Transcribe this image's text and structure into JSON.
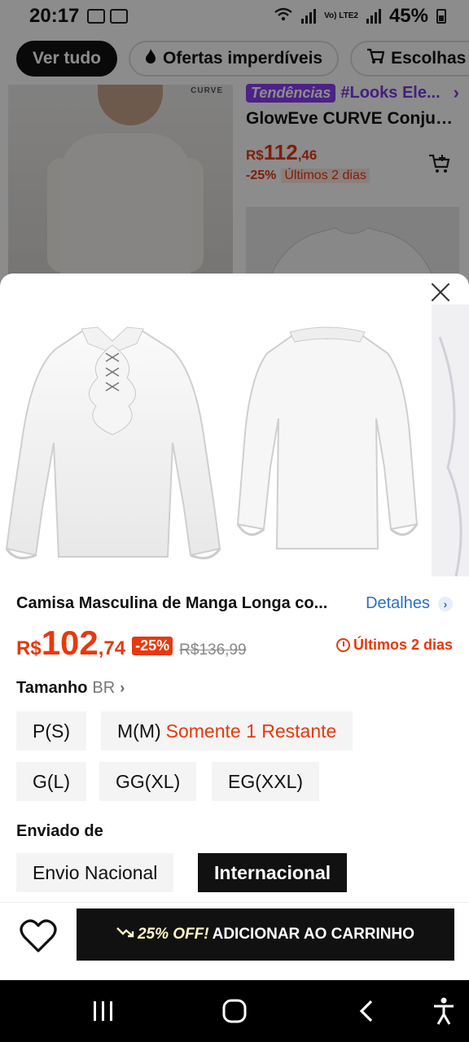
{
  "status_bar": {
    "time": "20:17",
    "network_label": "Vo) LTE2",
    "battery_pct": "45%",
    "battery_level": 0.45
  },
  "chips": [
    {
      "label": "Ver tudo",
      "active": true,
      "icon": ""
    },
    {
      "label": "Ofertas imperdíveis",
      "active": false,
      "icon": "fire-icon"
    },
    {
      "label": "Escolhas p",
      "active": false,
      "icon": "cart-icon"
    }
  ],
  "background_card": {
    "left_brand": "CURVE",
    "trend_badge": "Tendências",
    "trend_text": "#Looks Ele...",
    "title": "GlowEve CURVE Conjunt...",
    "price_currency": "R$",
    "price_int": "112",
    "price_dec": ",46",
    "discount": "-25%",
    "deal_label": "Últimos 2 dias"
  },
  "product": {
    "title": "Camisa Masculina de Manga Longa co...",
    "details_label": "Detalhes",
    "price_currency": "R$",
    "price_int": "102",
    "price_dec": ",74",
    "discount": "-25%",
    "original_price": "R$136,99",
    "timer_label": "Últimos 2 dias"
  },
  "size": {
    "label": "Tamanho",
    "region": "BR",
    "options": [
      {
        "label": "P(S)",
        "note": ""
      },
      {
        "label": "M(M)",
        "note": "Somente 1 Restante"
      },
      {
        "label": "G(L)",
        "note": ""
      },
      {
        "label": "GG(XL)",
        "note": ""
      },
      {
        "label": "EG(XXL)",
        "note": ""
      }
    ]
  },
  "shipping": {
    "label": "Enviado de",
    "options": [
      {
        "label": "Envio Nacional",
        "selected": false
      },
      {
        "label": "Internacional",
        "selected": true
      }
    ]
  },
  "footer": {
    "promo": "25% OFF!",
    "add_to_cart": "ADICIONAR AO CARRINHO"
  },
  "colors": {
    "accent_red": "#e8380d",
    "link_blue": "#2a6fc9",
    "trend_purple": "#8a3ff5",
    "primary_black": "#111111"
  }
}
